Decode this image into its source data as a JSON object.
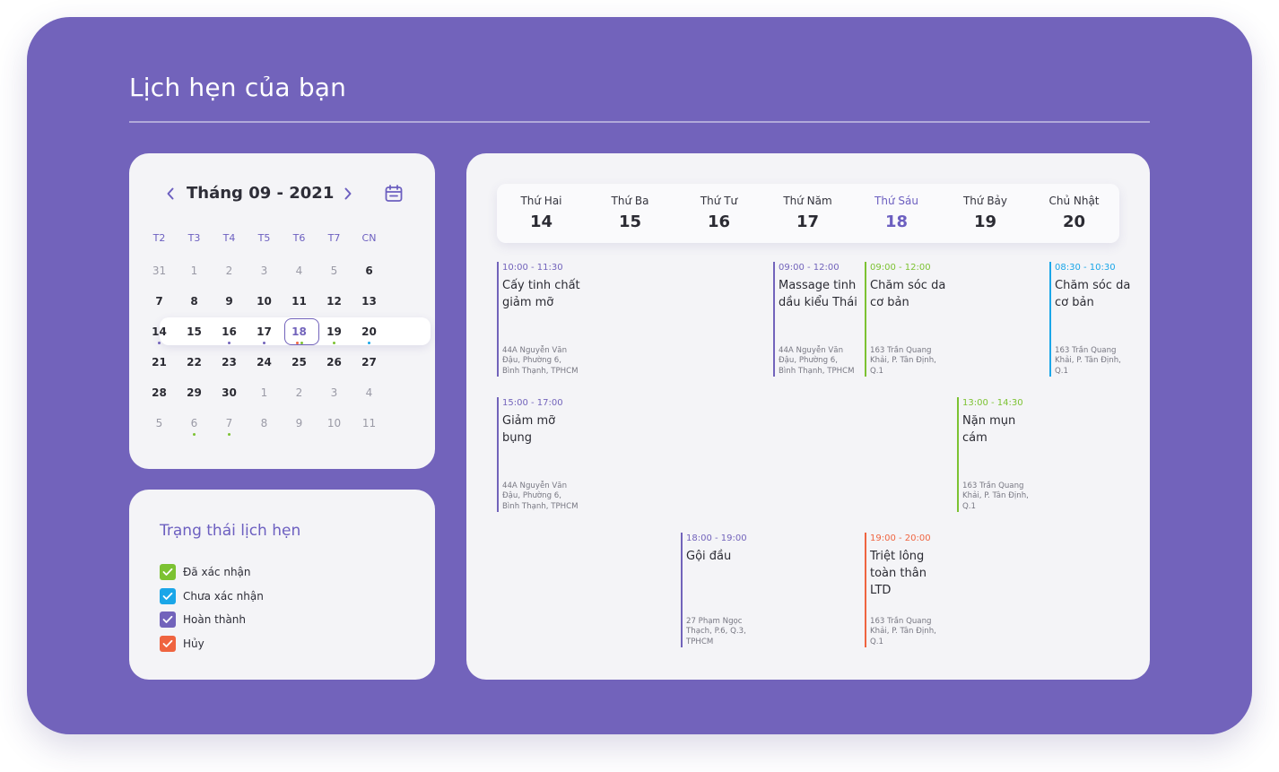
{
  "page": {
    "title": "Lịch hẹn của bạn"
  },
  "colors": {
    "background": "#7263bb",
    "accent": "#6c5fc0",
    "completed": "#7263bb",
    "confirmed": "#7cc232",
    "unconfirmed": "#1aa6e8",
    "cancelled": "#ef6440"
  },
  "calendar": {
    "month_label": "Tháng 09 - 2021",
    "prev_icon": "chevron-left-icon",
    "next_icon": "chevron-right-icon",
    "calendar_icon": "calendar-icon",
    "weekdays": [
      "T2",
      "T3",
      "T4",
      "T5",
      "T6",
      "T7",
      "CN"
    ],
    "selected_day": "18",
    "current_week_index": 2,
    "weeks": [
      [
        {
          "d": "31",
          "muted": true
        },
        {
          "d": "1",
          "muted": true
        },
        {
          "d": "2",
          "muted": true
        },
        {
          "d": "3",
          "muted": true
        },
        {
          "d": "4",
          "muted": true
        },
        {
          "d": "5",
          "muted": true
        },
        {
          "d": "6"
        }
      ],
      [
        {
          "d": "7"
        },
        {
          "d": "8"
        },
        {
          "d": "9"
        },
        {
          "d": "10"
        },
        {
          "d": "11"
        },
        {
          "d": "12"
        },
        {
          "d": "13"
        }
      ],
      [
        {
          "d": "14",
          "dots": [
            "completed"
          ]
        },
        {
          "d": "15"
        },
        {
          "d": "16",
          "dots": [
            "completed"
          ]
        },
        {
          "d": "17",
          "dots": [
            "completed"
          ]
        },
        {
          "d": "18",
          "dots": [
            "cancelled",
            "confirmed"
          ]
        },
        {
          "d": "19",
          "dots": [
            "confirmed"
          ]
        },
        {
          "d": "20",
          "dots": [
            "unconfirmed"
          ]
        }
      ],
      [
        {
          "d": "21"
        },
        {
          "d": "22"
        },
        {
          "d": "23"
        },
        {
          "d": "24"
        },
        {
          "d": "25"
        },
        {
          "d": "26"
        },
        {
          "d": "27"
        }
      ],
      [
        {
          "d": "28"
        },
        {
          "d": "29"
        },
        {
          "d": "30"
        },
        {
          "d": "1",
          "muted": true
        },
        {
          "d": "2",
          "muted": true
        },
        {
          "d": "3",
          "muted": true
        },
        {
          "d": "4",
          "muted": true
        }
      ],
      [
        {
          "d": "5",
          "muted": true
        },
        {
          "d": "6",
          "muted": true,
          "dots": [
            "confirmed"
          ]
        },
        {
          "d": "7",
          "muted": true,
          "dots": [
            "confirmed"
          ]
        },
        {
          "d": "8",
          "muted": true
        },
        {
          "d": "9",
          "muted": true
        },
        {
          "d": "10",
          "muted": true
        },
        {
          "d": "11",
          "muted": true
        }
      ]
    ]
  },
  "status": {
    "title": "Trạng thái lịch hẹn",
    "items": [
      {
        "label": "Đã xác nhận",
        "color": "#7cc232"
      },
      {
        "label": "Chưa xác nhận",
        "color": "#1aa6e8"
      },
      {
        "label": "Hoàn thành",
        "color": "#7263bb"
      },
      {
        "label": "Hủy",
        "color": "#ef6440"
      }
    ]
  },
  "schedule": {
    "active_day_index": 4,
    "days": [
      {
        "name": "Thứ Hai",
        "num": "14"
      },
      {
        "name": "Thứ Ba",
        "num": "15"
      },
      {
        "name": "Thứ Tư",
        "num": "16"
      },
      {
        "name": "Thứ Năm",
        "num": "17"
      },
      {
        "name": "Thứ Sáu",
        "num": "18"
      },
      {
        "name": "Thứ Bảy",
        "num": "19"
      },
      {
        "name": "Chủ Nhật",
        "num": "20"
      }
    ],
    "appointments": [
      {
        "day": 0,
        "slot": 0,
        "status": "completed",
        "time": "10:00 - 11:30",
        "title": "Cấy tinh chất giảm mỡ",
        "address": "44A Nguyễn Văn Đậu, Phường 6, Bình Thạnh, TPHCM"
      },
      {
        "day": 3,
        "slot": 0,
        "status": "completed",
        "time": "09:00 - 12:00",
        "title": "Massage tinh dầu kiểu Thái",
        "address": "44A Nguyễn Văn Đậu, Phường 6, Bình Thạnh, TPHCM"
      },
      {
        "day": 4,
        "slot": 0,
        "status": "confirmed",
        "time": "09:00 - 12:00",
        "title": "Chăm sóc da cơ bản",
        "address": "163 Trần Quang Khải, P. Tân Định, Q.1"
      },
      {
        "day": 6,
        "slot": 0,
        "status": "unconfirmed",
        "time": "08:30 - 10:30",
        "title": "Chăm sóc da cơ bản",
        "address": "163 Trần Quang Khải, P. Tân Định, Q.1"
      },
      {
        "day": 0,
        "slot": 1,
        "status": "completed",
        "time": "15:00 - 17:00",
        "title": "Giảm mỡ bụng",
        "address": "44A Nguyễn Văn Đậu, Phường 6, Bình Thạnh, TPHCM"
      },
      {
        "day": 5,
        "slot": 1,
        "status": "confirmed",
        "time": "13:00 - 14:30",
        "title": "Nặn mụn cám",
        "address": "163 Trần Quang Khải, P. Tân Định, Q.1"
      },
      {
        "day": 2,
        "slot": 2,
        "status": "completed",
        "time": "18:00 - 19:00",
        "title": "Gội đầu",
        "address": "27 Phạm Ngọc Thạch, P.6, Q.3, TPHCM"
      },
      {
        "day": 4,
        "slot": 2,
        "status": "cancelled",
        "time": "19:00 - 20:00",
        "title": "Triệt lông toàn thân LTD",
        "address": "163 Trần Quang Khải, P. Tân Định, Q.1"
      }
    ]
  }
}
